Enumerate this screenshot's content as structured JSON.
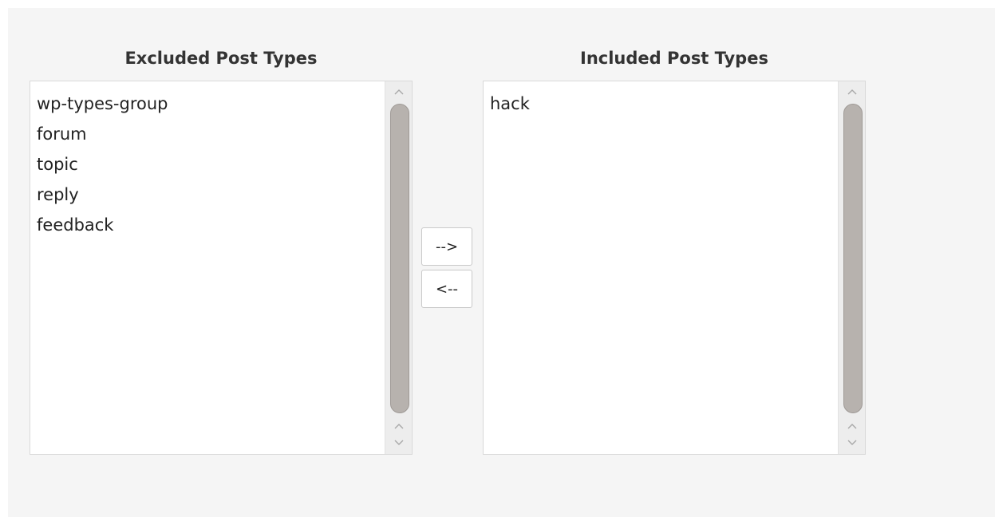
{
  "excluded": {
    "title": "Excluded Post Types",
    "items": [
      "wp-types-group",
      "forum",
      "topic",
      "reply",
      "feedback"
    ]
  },
  "included": {
    "title": "Included Post Types",
    "items": [
      "hack"
    ]
  },
  "controls": {
    "add_label": "-->",
    "remove_label": "<--"
  },
  "colors": {
    "panel_background": "#f5f5f5",
    "listbox_background": "#ffffff",
    "scroll_thumb": "#b7b2ae"
  }
}
